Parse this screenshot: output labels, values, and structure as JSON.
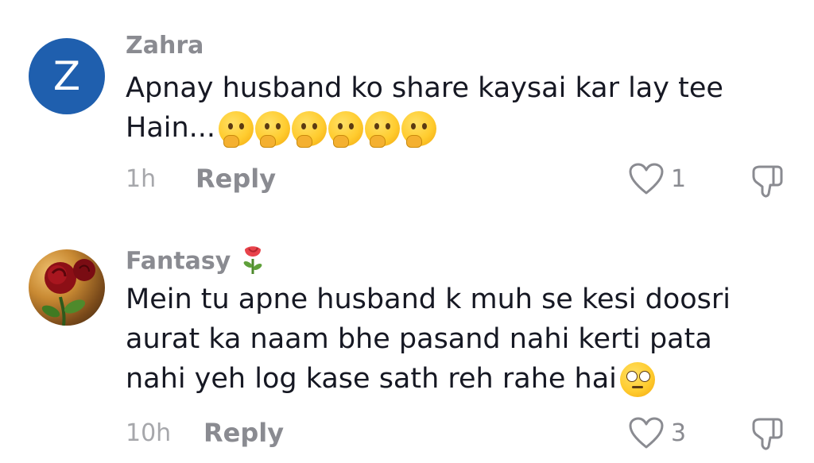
{
  "comments": [
    {
      "avatar_letter": "Z",
      "username": "Zahra",
      "text": "Apnay husband ko share kaysai kar lay tee Hain...",
      "emoji_count": 6,
      "time": "1h",
      "reply_label": "Reply",
      "likes": "1"
    },
    {
      "username": "Fantasy",
      "text": "Mein tu apne husband k muh se kesi doosri aurat ka naam bhe pasand nahi kerti pata nahi yeh log kase sath reh rahe hai",
      "time": "10h",
      "reply_label": "Reply",
      "likes": "3"
    }
  ],
  "icons": {
    "like": "heart-outline-icon",
    "dislike": "thumbs-down-outline-icon",
    "name_badge": "rose-icon",
    "thinking_emoji": "thinking-face-emoji",
    "eye_roll_emoji": "face-with-rolling-eyes-emoji"
  },
  "colors": {
    "avatar_bg": "#1f5fae",
    "username": "#8a8b91",
    "text": "#161823",
    "meta": "#a6a7ab"
  }
}
